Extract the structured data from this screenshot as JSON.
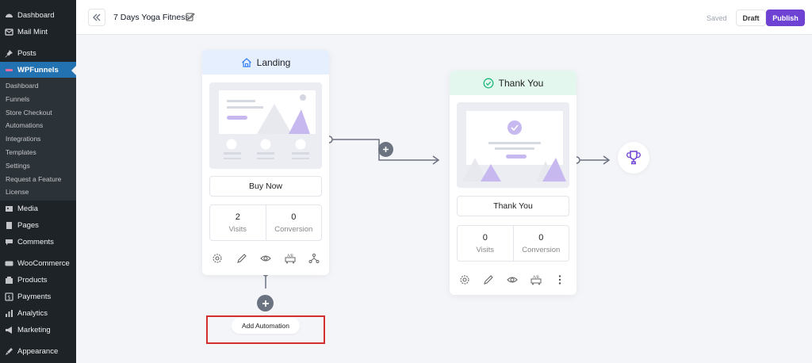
{
  "sidebar": {
    "items_top": [
      {
        "label": "Dashboard",
        "icon": "dashboard-icon"
      },
      {
        "label": "Mail Mint",
        "icon": "mail-icon"
      }
    ],
    "posts": {
      "label": "Posts",
      "icon": "pin-icon"
    },
    "active": {
      "label": "WPFunnels",
      "icon": "wpfunnels-icon"
    },
    "submenu": [
      "Dashboard",
      "Funnels",
      "Store Checkout",
      "Automations",
      "Integrations",
      "Templates",
      "Settings",
      "Request a Feature",
      "License"
    ],
    "items_bottom": [
      {
        "label": "Media",
        "icon": "media-icon"
      },
      {
        "label": "Pages",
        "icon": "pages-icon"
      },
      {
        "label": "Comments",
        "icon": "comments-icon"
      },
      {
        "label": "WooCommerce",
        "icon": "woocommerce-icon"
      },
      {
        "label": "Products",
        "icon": "products-icon"
      },
      {
        "label": "Payments",
        "icon": "payments-icon"
      },
      {
        "label": "Analytics",
        "icon": "analytics-icon"
      },
      {
        "label": "Marketing",
        "icon": "marketing-icon"
      },
      {
        "label": "Appearance",
        "icon": "appearance-icon"
      }
    ]
  },
  "header": {
    "title": "7 Days Yoga Fitness",
    "saved": "Saved",
    "draft": "Draft",
    "publish": "Publish"
  },
  "landing": {
    "title": "Landing",
    "action": "Buy Now",
    "visits_value": "2",
    "visits_label": "Visits",
    "conversion_value": "0",
    "conversion_label": "Conversion"
  },
  "thankyou": {
    "title": "Thank You",
    "action": "Thank You",
    "visits_value": "0",
    "visits_label": "Visits",
    "conversion_value": "0",
    "conversion_label": "Conversion"
  },
  "automation": {
    "label": "Add Automation"
  },
  "colors": {
    "accent": "#6e42d3",
    "sidebar_bg": "#1d2327",
    "active_bg": "#2271b1",
    "landing_head": "#e6effd",
    "thankyou_head": "#e3f7ee",
    "highlight": "#d32f2f"
  }
}
